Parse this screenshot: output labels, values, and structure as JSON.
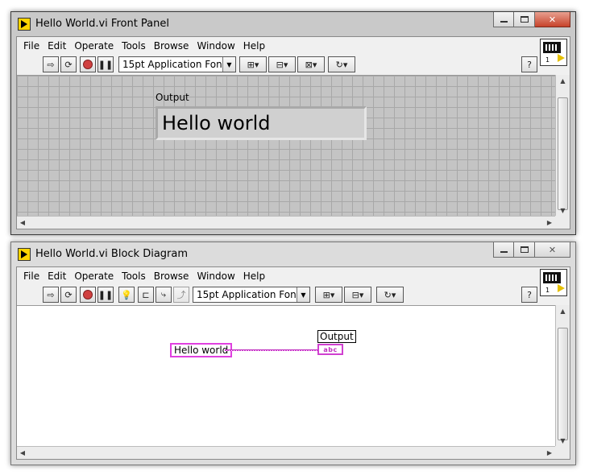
{
  "front_panel": {
    "title": "Hello World.vi Front Panel",
    "menu": [
      "File",
      "Edit",
      "Operate",
      "Tools",
      "Browse",
      "Window",
      "Help"
    ],
    "font_select": "15pt Application Font",
    "vi_icon_number": "1",
    "output_label": "Output",
    "output_value": "Hello world"
  },
  "block_diagram": {
    "title": "Hello World.vi Block Diagram",
    "menu": [
      "File",
      "Edit",
      "Operate",
      "Tools",
      "Browse",
      "Window",
      "Help"
    ],
    "font_select": "15pt Application Font",
    "vi_icon_number": "1",
    "output_label": "Output",
    "string_constant": "Hello world",
    "terminal_text": "abc"
  },
  "colors": {
    "string_wire": "#d040d0",
    "close_active": "#c7432b"
  },
  "icons": {
    "run": "run-arrow-icon",
    "run_continuously": "run-continuously-icon",
    "abort": "abort-icon",
    "pause": "pause-icon",
    "highlight": "highlight-execution-icon",
    "help": "context-help-icon"
  }
}
